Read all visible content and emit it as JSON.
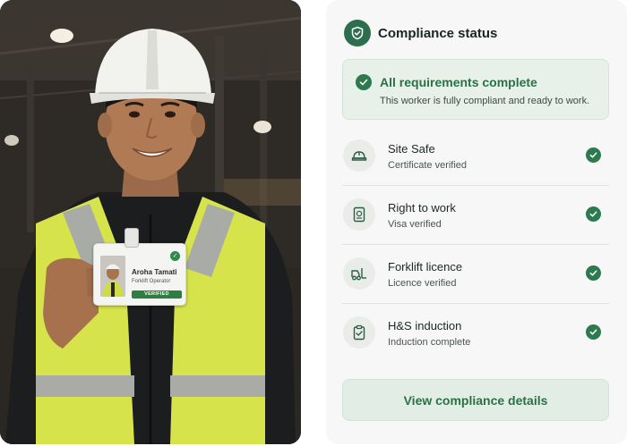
{
  "photo": {
    "badge": {
      "name": "Aroha Tamati",
      "role": "Forklift Operator",
      "status": "VERIFIED"
    }
  },
  "compliance": {
    "title": "Compliance status",
    "summary": {
      "title": "All requirements complete",
      "text": "This worker is fully compliant and ready to work."
    },
    "requirements": [
      {
        "icon": "hard-hat-icon",
        "title": "Site Safe",
        "status": "Certificate verified"
      },
      {
        "icon": "passport-icon",
        "title": "Right to work",
        "status": "Visa verified"
      },
      {
        "icon": "forklift-icon",
        "title": "Forklift licence",
        "status": "Licence verified"
      },
      {
        "icon": "clipboard-check-icon",
        "title": "H&S induction",
        "status": "Induction complete"
      }
    ],
    "cta_label": "View compliance details"
  },
  "colors": {
    "accent_green": "#2d7a4f",
    "summary_bg": "#e7f1ea",
    "panel_bg": "#f6f7f6",
    "vest_yellow": "#d6e34a"
  }
}
